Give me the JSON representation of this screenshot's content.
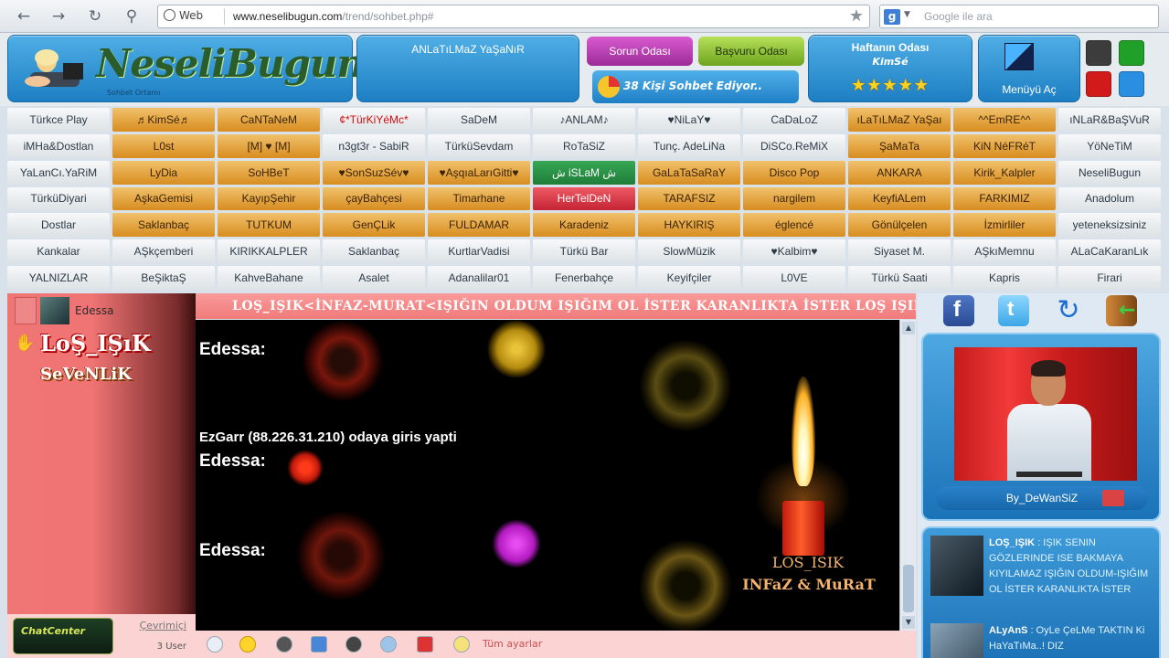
{
  "browser": {
    "url_prefix": "Web",
    "url_domain": "www.neselibugun.com",
    "url_path": "/trend/sohbet.php#",
    "search_placeholder": "Google ile ara"
  },
  "header": {
    "logo": "NeseliBugun",
    "logo_sub": "Sohbet Ortamı",
    "slogan": "ANLaTıLMaZ YaŞaNıR",
    "sorun_odasi": "Sorun Odası",
    "basvuru_odasi": "Başvuru Odası",
    "chatting": "38 Kişi Sohbet Ediyor..",
    "week_title": "Haftanın Odası",
    "week_room": "KimSé",
    "week_stars": "★★★★★",
    "menu_label": "Menüyü Aç"
  },
  "rooms": [
    [
      "Türkce Play",
      "♬KimSé♬",
      "CaNTaNeM",
      "¢*TürKiYéMc*",
      "SaDeM",
      "♪ANLAM♪",
      "♥NiLaY♥",
      "CaDaLoZ",
      "ıLaTıLMaZ YaŞaı",
      "^^EmRE^^",
      "ıNLaR&BaŞVuR"
    ],
    [
      "iMHa&Dostlan",
      "L0st",
      "[M] ♥ [M]",
      "n3gt3r - SabiR",
      "TürküSevdam",
      "RoTaSiZ",
      "Tunç. AdeLiNa",
      "DiSCo.ReMiX",
      "ŞaMaTa",
      "KiN NéFRéT",
      "YöNeTiM"
    ],
    [
      "YaLanCı.YaRiM",
      "LyDia",
      "SoHBeT",
      "♥SonSuzSév♥",
      "♥AşqıaLarıGitti♥",
      "ش iSLaM ش",
      "GaLaTaSaRaY",
      "Disco Pop",
      "ANKARA",
      "Kirik_Kalpler",
      "NeseliBugun"
    ],
    [
      "TürküDiyari",
      "AşkaGemisi",
      "KayıpŞehir",
      "çayBahçesi",
      "Timarhane",
      "HerTelDeN",
      "TARAFSIZ",
      "nargilem",
      "KeyfiALem",
      "FARKIMIZ",
      "Anadolum"
    ],
    [
      "Dostlar",
      "Saklanbaç",
      "TUTKUM",
      "GenÇLik",
      "FULDAMAR",
      "Karadeniz",
      "HAYKIRIŞ",
      "églencé",
      "Gönülçelen",
      "İzmirliler",
      "yeteneksizsiniz"
    ],
    [
      "Kankalar",
      "AŞkçemberi",
      "KIRIKKALPLER",
      "Saklanbaç",
      "KurtlarVadisi",
      "Türkü Bar",
      "SlowMüzik",
      "♥Kalbim♥",
      "Siyaset M.",
      "AŞkıMemnu",
      "ALaCaKaranLık"
    ],
    [
      "YALNIZLAR",
      "BeŞiktaŞ",
      "KahveBahane",
      "Asalet",
      "Adanalilar01",
      "Fenerbahçe",
      "Keyifçiler",
      "L0VE",
      "Türkü Saati",
      "Kapris",
      "Firari"
    ]
  ],
  "room_styles": [
    [
      "g",
      "o",
      "o",
      "g",
      "g",
      "g",
      "g",
      "g",
      "o",
      "o",
      "g"
    ],
    [
      "g",
      "o",
      "o",
      "g",
      "g",
      "g",
      "g",
      "g",
      "o",
      "o",
      "g"
    ],
    [
      "g",
      "o",
      "o",
      "o",
      "o",
      "gr",
      "o",
      "o",
      "o",
      "o",
      "g"
    ],
    [
      "g",
      "o",
      "o",
      "o",
      "o",
      "rd",
      "o",
      "o",
      "o",
      "o",
      "g"
    ],
    [
      "g",
      "o",
      "o",
      "o",
      "o",
      "o",
      "o",
      "o",
      "o",
      "o",
      "g"
    ],
    [
      "g",
      "g",
      "g",
      "g",
      "g",
      "g",
      "g",
      "g",
      "g",
      "g",
      "g"
    ],
    [
      "g",
      "g",
      "g",
      "g",
      "g",
      "g",
      "g",
      "g",
      "g",
      "g",
      "g"
    ]
  ],
  "left": {
    "user": "Edessa",
    "logo_top": "LoŞ_IŞıK",
    "logo_bottom": "SeVeNLiK",
    "chat_logo": "ChatCenter",
    "online_label": "Çevrimiçi",
    "online_count": "3 User"
  },
  "chat": {
    "marquee": "LOŞ_IŞIK<İNFAZ-MURAT<IŞIĞIN OLDUM IŞIĞIM OL İSTER KARANLIKTA İSTER LOŞ IŞIKTA",
    "messages": [
      {
        "text": "Edessa:"
      },
      {
        "text": "EzGarr (88.226.31.210) odaya giris yapti"
      },
      {
        "text": "Edessa:"
      },
      {
        "text": "Edessa:"
      }
    ],
    "candle_line1": "LOS_ISIK",
    "candle_line2": "INFaZ & MuRaT"
  },
  "toolbar": {
    "settings_label": "Tüm ayarlar"
  },
  "right": {
    "profile_name": "By_DeWanSiZ",
    "messages": [
      {
        "user": "LOŞ_IŞIK",
        "text": ": IŞIK SENIN GÖZLERINDE ISE BAKMAYA KIYILAMAZ IŞIĞIN OLDUM-IŞIĞIM OL İSTER KARANLIKTA İSTER"
      },
      {
        "user": "ALyAnS",
        "text": ": OyLe ÇeLMe TAKTIN Ki HaYaTıMa..! DIZ"
      }
    ]
  },
  "colors": {
    "accent_blue": "#1d7fc3",
    "room_orange": "#d88d1f",
    "panel_pink": "#f07575"
  }
}
